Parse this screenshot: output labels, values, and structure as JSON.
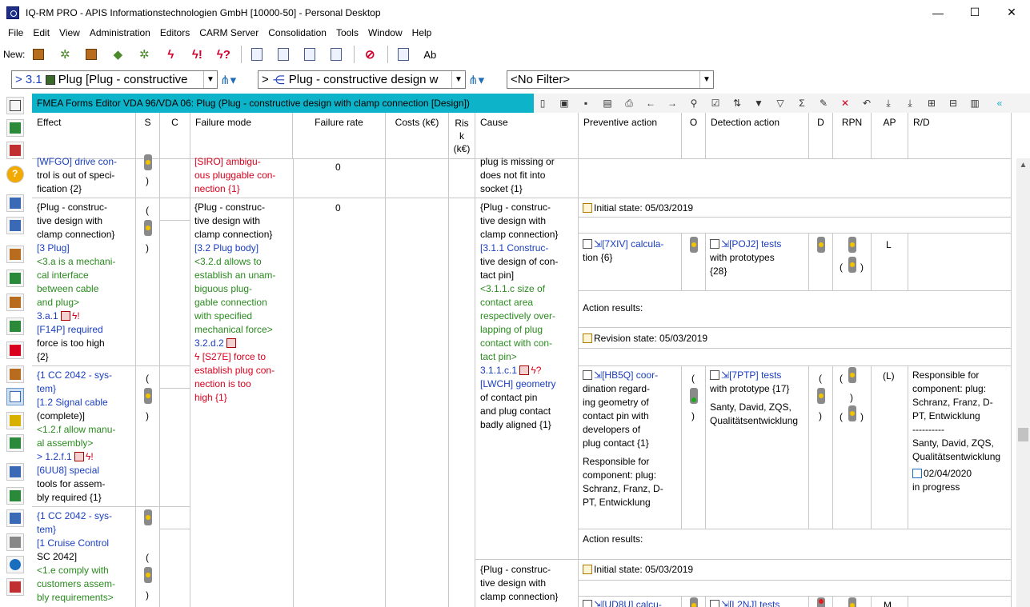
{
  "window": {
    "title": "IQ-RM PRO - APIS Informationstechnologien GmbH [10000-50] - Personal Desktop",
    "minimize": "—",
    "maximize": "☐",
    "close": "✕"
  },
  "menu": [
    "File",
    "Edit",
    "View",
    "Administration",
    "Editors",
    "CARM Server",
    "Consolidation",
    "Tools",
    "Window",
    "Help"
  ],
  "toolbar": {
    "new_label": "New:"
  },
  "selectors": {
    "structure_prefix": "> 3.1",
    "structure_value": "Plug [Plug - constructive",
    "function_prefix": ">",
    "function_value": "Plug - constructive design w",
    "filter_value": "<No Filter>"
  },
  "editor": {
    "title": "FMEA Forms Editor VDA 96/VDA 06: Plug (Plug - constructive design with clamp connection [Design])"
  },
  "columns": [
    "Effect",
    "S",
    "C",
    "Failure mode",
    "Failure rate",
    "Costs (k€)",
    "Risk (k€)",
    "Cause",
    "Preventive action",
    "O",
    "Detection action",
    "D",
    "RPN",
    "AP",
    "R/D"
  ],
  "risk_header": [
    "Ris",
    "k",
    "(k€)"
  ],
  "rows": {
    "top_effect": [
      "[WFGO] drive con-",
      "trol is out of speci-",
      "fication {2}"
    ],
    "top_failure": [
      "[SIRO] ambigu-",
      "ous pluggable con-",
      "nection {1}"
    ],
    "top_rate": "0",
    "top_cause": [
      "plug is missing or",
      "does not fit into",
      "socket {1}"
    ],
    "effect1": [
      "{Plug - construc-",
      "tive design with",
      "clamp connection}",
      "[3  Plug]",
      "<3.a is a mechani-",
      "cal interface",
      "between cable",
      "and plug>",
      "3.a.1",
      "[F14P] required",
      "force is too high",
      "{2}"
    ],
    "effect2": [
      "{1 CC 2042 - sys-",
      "tem}",
      "[1.2  Signal cable",
      "(complete)]",
      "<1.2.f allow manu-",
      "al assembly>",
      "> 1.2.f.1",
      "[6UU8] special",
      "tools for assem-",
      "bly required {1}"
    ],
    "effect3": [
      "{1 CC 2042 - sys-",
      "tem}",
      "[1  Cruise Control",
      "SC 2042]",
      "<1.e comply with",
      "customers assem-",
      "bly requirements>"
    ],
    "failure_mode": [
      "{Plug - construc-",
      "tive design with",
      "clamp connection}",
      "[3.2  Plug body]",
      "<3.2.d allows to",
      "establish an unam-",
      "biguous plug-",
      "gable connection",
      "with specified",
      "mechanical force>",
      "3.2.d.2",
      "[S27E] force to",
      "establish plug con-",
      "nection is too",
      "high {1}"
    ],
    "failure_rate": "0",
    "cause1": [
      "{Plug - construc-",
      "tive design with",
      "clamp connection}",
      "[3.1.1  Construc-",
      "tive design of con-",
      "tact pin]",
      "<3.1.1.c size of",
      "contact area",
      "respectively over-",
      "lapping of plug",
      "contact with con-",
      "tact pin>",
      "3.1.1.c.1",
      "[LWCH] geometry",
      "of contact pin",
      "and plug contact",
      "badly aligned {1}"
    ],
    "cause2": [
      "{Plug - construc-",
      "tive design with",
      "clamp connection}"
    ],
    "initial_state_1": "Initial state: 05/03/2019",
    "prev1": [
      "[7XIV] calcula-",
      "tion {6}"
    ],
    "det1": [
      "[POJ2] tests",
      "with prototypes",
      "{28}"
    ],
    "ap1": "L",
    "action_results_1": "Action results:",
    "revision_state": "Revision state: 05/03/2019",
    "prev2": [
      "[HB5Q] coor-",
      "dination regard-",
      "ing geometry of",
      "contact pin with",
      "developers of",
      "plug contact {1}",
      "Responsible for",
      "component: plug:",
      "Schranz, Franz, D-",
      "PT, Entwicklung"
    ],
    "det2": [
      "[7PTP] tests",
      "with prototype {17}",
      "Santy, David, ZQS,",
      "Qualitätsentwicklung"
    ],
    "ap2": "(L)",
    "rd2": [
      "Responsible for",
      "component: plug:",
      "Schranz, Franz, D-",
      "PT, Entwicklung",
      "----------",
      "Santy, David, ZQS,",
      "Qualitätsentwicklung",
      "02/04/2020",
      "in progress"
    ],
    "action_results_2": "Action results:",
    "initial_state_2": "Initial state: 05/03/2019",
    "prev3": "[UD8U] calcu-",
    "det3": "[L2NJ] tests",
    "ap3": "M"
  }
}
